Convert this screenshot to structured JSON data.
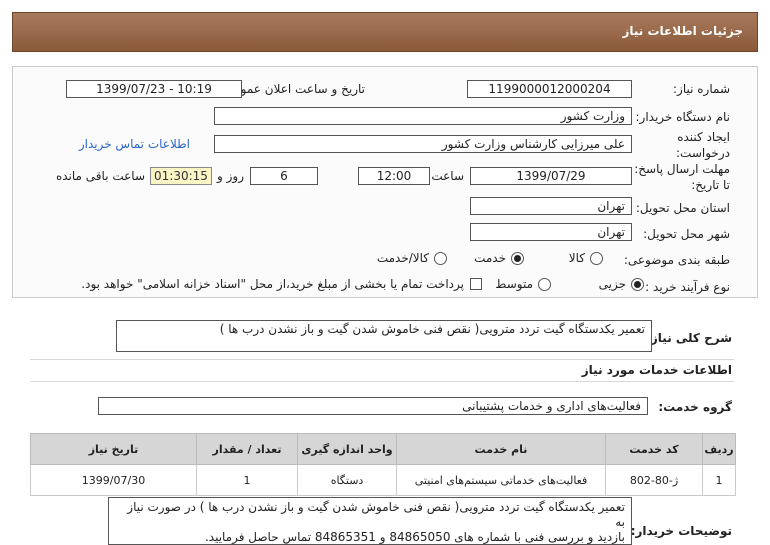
{
  "header": {
    "title": "جزئیات اطلاعات نیاز"
  },
  "form": {
    "need_number_label": "شماره نیاز:",
    "need_number": "1199000012000204",
    "announce_label": "تاریخ و ساعت اعلان عمومی:",
    "announce_value": "1399/07/23 - 10:19",
    "buyer_org_label": "نام دستگاه خریدار:",
    "buyer_org": "وزارت کشور",
    "requester_label_1": "ایجاد کننده",
    "requester_label_2": "درخواست:",
    "requester": "علی میرزایی کارشناس وزارت کشور",
    "buyer_contact_link": "اطلاعات تماس خریدار",
    "deadline_label_1": "مهلت ارسال پاسخ:",
    "deadline_label_2": "تا تاریخ:",
    "deadline_date": "1399/07/29",
    "time_label": "ساعت",
    "deadline_time": "12:00",
    "days_value": "6",
    "days_label": "روز و",
    "remaining_time": "01:30:15",
    "remaining_label": "ساعت باقی مانده",
    "province_label": "استان محل تحویل:",
    "province": "تهران",
    "city_label": "شهر محل تحویل:",
    "city": "تهران",
    "category_label": "طبقه بندی موضوعی:",
    "category_options": [
      "کالا",
      "خدمت",
      "کالا/خدمت"
    ],
    "category_selected": "خدمت",
    "process_label": "نوع فرآیند خرید :",
    "process_options": [
      "جزیی",
      "متوسط"
    ],
    "process_selected": "جزیی",
    "payment_note": "پرداخت تمام یا بخشی از مبلغ خرید،از محل \"اسناد خزانه اسلامی\" خواهد بود."
  },
  "summary": {
    "label": "شرح کلی نیاز:",
    "value": "تعمیر یکدستگاه گیت تردد مترویی( نقص فنی خاموش شدن گیت و باز نشدن درب ها )"
  },
  "services_section": {
    "title": "اطلاعات خدمات مورد نیاز"
  },
  "service_group": {
    "label": "گروه خدمت:",
    "value": "فعالیت‌های اداری و خدمات پشتیبانی"
  },
  "table": {
    "headers": [
      "ردیف",
      "کد خدمت",
      "نام خدمت",
      "واحد اندازه گیری",
      "تعداد / مقدار",
      "تاریخ نیاز"
    ],
    "rows": [
      [
        "1",
        "ژ-80-802",
        "فعالیت‌های خدماتی سیستم‌های امنیتی",
        "دستگاه",
        "1",
        "1399/07/30"
      ]
    ]
  },
  "buyer_notes": {
    "label": "توضیحات خریدار:",
    "lines": [
      "تعمیر یکدستگاه گیت تردد مترویی( نقص فنی خاموش شدن گیت و باز نشدن درب ها ) در صورت نیاز به",
      "بازدید و بررسی فنی با شماره های 84865050 و 84865351 تماس حاصل فرمایید."
    ]
  }
}
